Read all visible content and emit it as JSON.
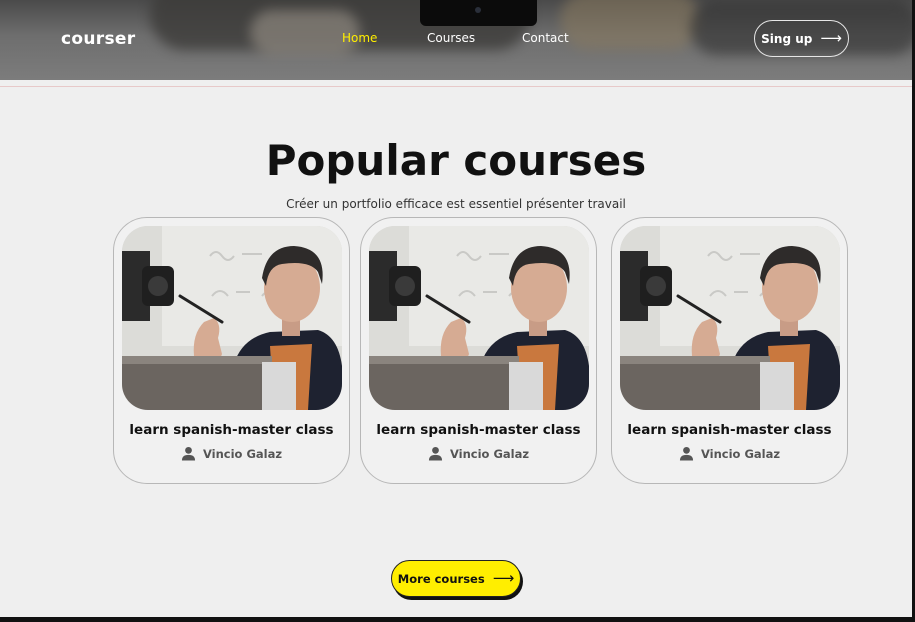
{
  "header": {
    "logo": "courser",
    "nav": [
      {
        "label": "Home",
        "active": true
      },
      {
        "label": "Courses",
        "active": false
      },
      {
        "label": "Contact",
        "active": false
      }
    ],
    "signup_label": "Sing up",
    "signup_icon": "arrow-right-icon",
    "active_color": "#ffee00"
  },
  "main": {
    "title": "Popular courses",
    "subtitle": "Créer un portfolio efficace est essentiel  présenter  travail",
    "courses": [
      {
        "title": "learn spanish-master class",
        "author": "Vincio Galaz",
        "author_icon": "user-icon"
      },
      {
        "title": "learn spanish-master class",
        "author": "Vincio Galaz",
        "author_icon": "user-icon"
      },
      {
        "title": "learn spanish-master class",
        "author": "Vincio Galaz",
        "author_icon": "user-icon"
      }
    ],
    "more_label": "More courses",
    "more_icon": "arrow-right-icon",
    "button_color": "#ffee00"
  }
}
